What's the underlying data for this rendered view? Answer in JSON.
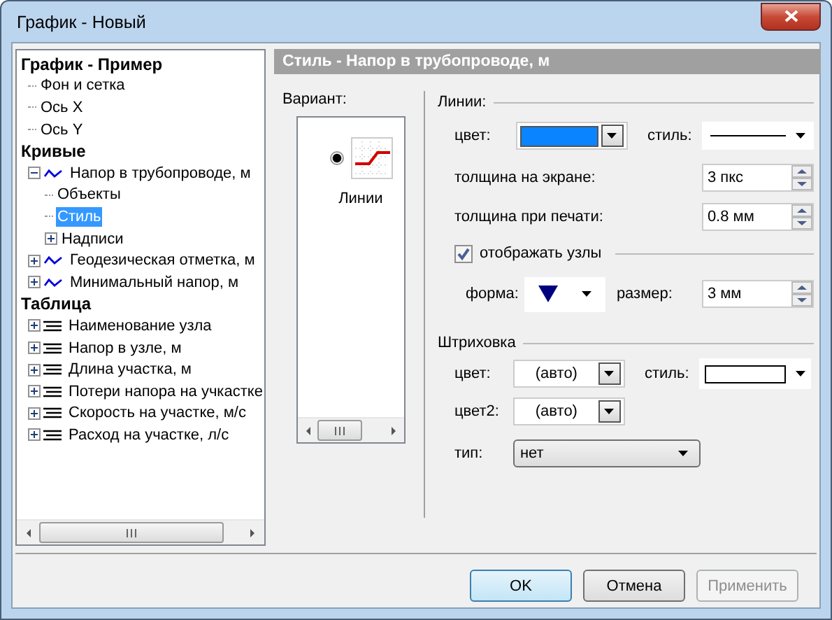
{
  "window": {
    "title": "График - Новый"
  },
  "tree": {
    "items": [
      {
        "label": "График - Пример",
        "kind": "group",
        "selected": false,
        "children": [
          {
            "label": "Фон и сетка",
            "selected": false
          },
          {
            "label": "Ось X",
            "selected": false
          },
          {
            "label": "Ось Y",
            "selected": false
          }
        ]
      },
      {
        "label": "Кривые",
        "kind": "group",
        "selected": false,
        "children": [
          {
            "label": "Напор в трубопроводе, м",
            "kind": "curve",
            "selected": false,
            "expanded": true,
            "children": [
              {
                "label": "Объекты",
                "selected": false
              },
              {
                "label": "Стиль",
                "selected": true
              },
              {
                "label": "Надписи",
                "selected": false,
                "expanded": false
              }
            ]
          },
          {
            "label": "Геодезическая отметка, м",
            "kind": "curve",
            "selected": false,
            "expanded": false
          },
          {
            "label": "Минимальный напор, м",
            "kind": "curve",
            "selected": false,
            "expanded": false
          }
        ]
      },
      {
        "label": "Таблица",
        "kind": "group",
        "selected": false,
        "children": [
          {
            "label": "Наименование узла",
            "kind": "column",
            "selected": false,
            "expanded": false
          },
          {
            "label": "Напор в узле, м",
            "kind": "column",
            "selected": false,
            "expanded": false
          },
          {
            "label": "Длина участка, м",
            "kind": "column",
            "selected": false,
            "expanded": false
          },
          {
            "label": "Потери напора на учкастке",
            "kind": "column",
            "selected": false,
            "expanded": false
          },
          {
            "label": "Скорость на участке, м/с",
            "kind": "column",
            "selected": false,
            "expanded": false
          },
          {
            "label": "Расход на участке, л/с",
            "kind": "column",
            "selected": false,
            "expanded": false
          }
        ]
      }
    ]
  },
  "panel": {
    "title": "Стиль - Напор в трубопроводе, м"
  },
  "variant": {
    "label": "Вариант:",
    "options": [
      {
        "label": "Линии",
        "selected": true
      }
    ]
  },
  "lines": {
    "legend": "Линии:",
    "color_label": "цвет:",
    "color": "#0a84ff",
    "style_label": "стиль:",
    "screen_width_label": "толщина на экране:",
    "screen_width": "3 пкс",
    "print_width_label": "толщина при печати:",
    "print_width": "0.8 мм"
  },
  "nodes": {
    "label": "отображать узлы",
    "checked": true,
    "shape_label": "форма:",
    "marker": {
      "kind": "triangle"
    },
    "size_label": "размер:",
    "size": "3 мм"
  },
  "hatch": {
    "legend": "Штриховка",
    "color_label": "цвет:",
    "color_value": "(авто)",
    "style_label": "стиль:",
    "color2_label": "цвет2:",
    "color2_value": "(авто)",
    "type_label": "тип:",
    "type": "нет"
  },
  "buttons": [
    {
      "label": "OK",
      "default": true,
      "disabled": false
    },
    {
      "label": "Отмена",
      "default": false,
      "disabled": false
    },
    {
      "label": "Применить",
      "default": false,
      "disabled": true
    }
  ]
}
